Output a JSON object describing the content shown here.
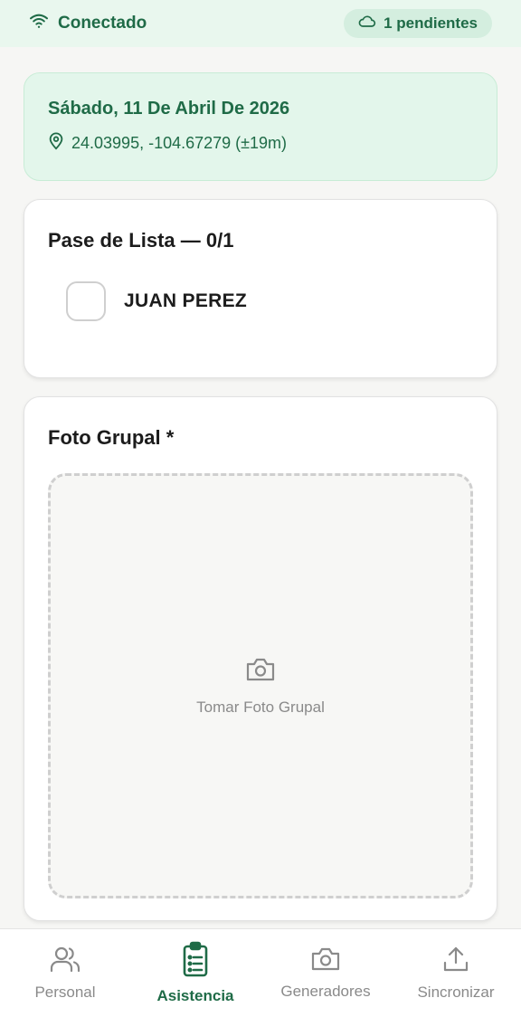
{
  "status": {
    "connection_label": "Conectado",
    "pending_label": "1 pendientes",
    "accent": "#1f6b47"
  },
  "session": {
    "date": "Sábado, 11 De Abril De 2026",
    "location": "24.03995, -104.67279 (±19m)"
  },
  "attendance": {
    "title": "Pase de Lista — 0/1",
    "people": [
      {
        "name": "JUAN PEREZ",
        "checked": false
      }
    ]
  },
  "photo": {
    "title": "Foto Grupal *",
    "capture_label": "Tomar Foto Grupal"
  },
  "nav": {
    "items": [
      {
        "label": "Personal",
        "icon": "users-icon",
        "active": false
      },
      {
        "label": "Asistencia",
        "icon": "clipboard-list-icon",
        "active": true
      },
      {
        "label": "Generadores",
        "icon": "camera-icon",
        "active": false
      },
      {
        "label": "Sincronizar",
        "icon": "upload-icon",
        "active": false
      }
    ]
  }
}
